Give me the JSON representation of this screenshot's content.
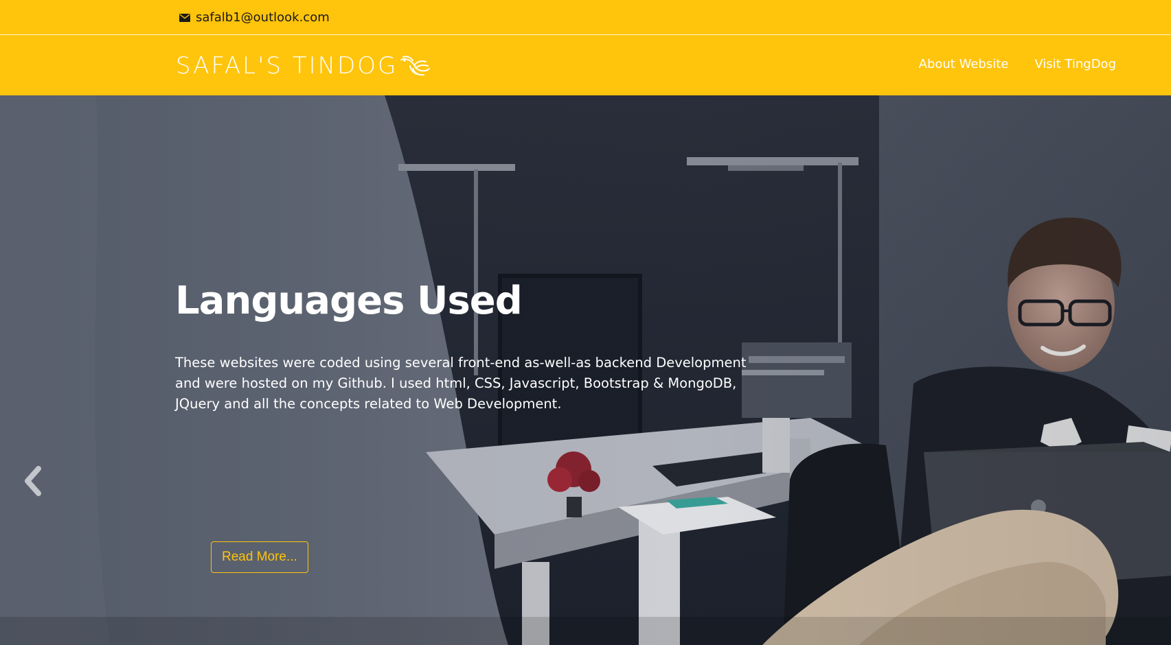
{
  "topbar": {
    "email": "safalb1@outlook.com",
    "icon": "mail-icon"
  },
  "navbar": {
    "brand": "SAFAL'S TINDOG",
    "brand_icon": "bird-icon",
    "links": [
      {
        "label": "About Website"
      },
      {
        "label": "Visit TingDog"
      }
    ]
  },
  "hero": {
    "title": "Languages Used",
    "text": "These websites were coded using several front-end as-well-as backend Development and were hosted on my Github. I used html, CSS, Javascript, Bootstrap & MongoDB, JQuery and all the concepts related to Web Development.",
    "button_label": "Read More...",
    "prev_icon": "chevron-left-icon"
  },
  "colors": {
    "brand_yellow": "#ffc40c",
    "text_white": "#ffffff",
    "text_dark": "#1a1a1a"
  }
}
